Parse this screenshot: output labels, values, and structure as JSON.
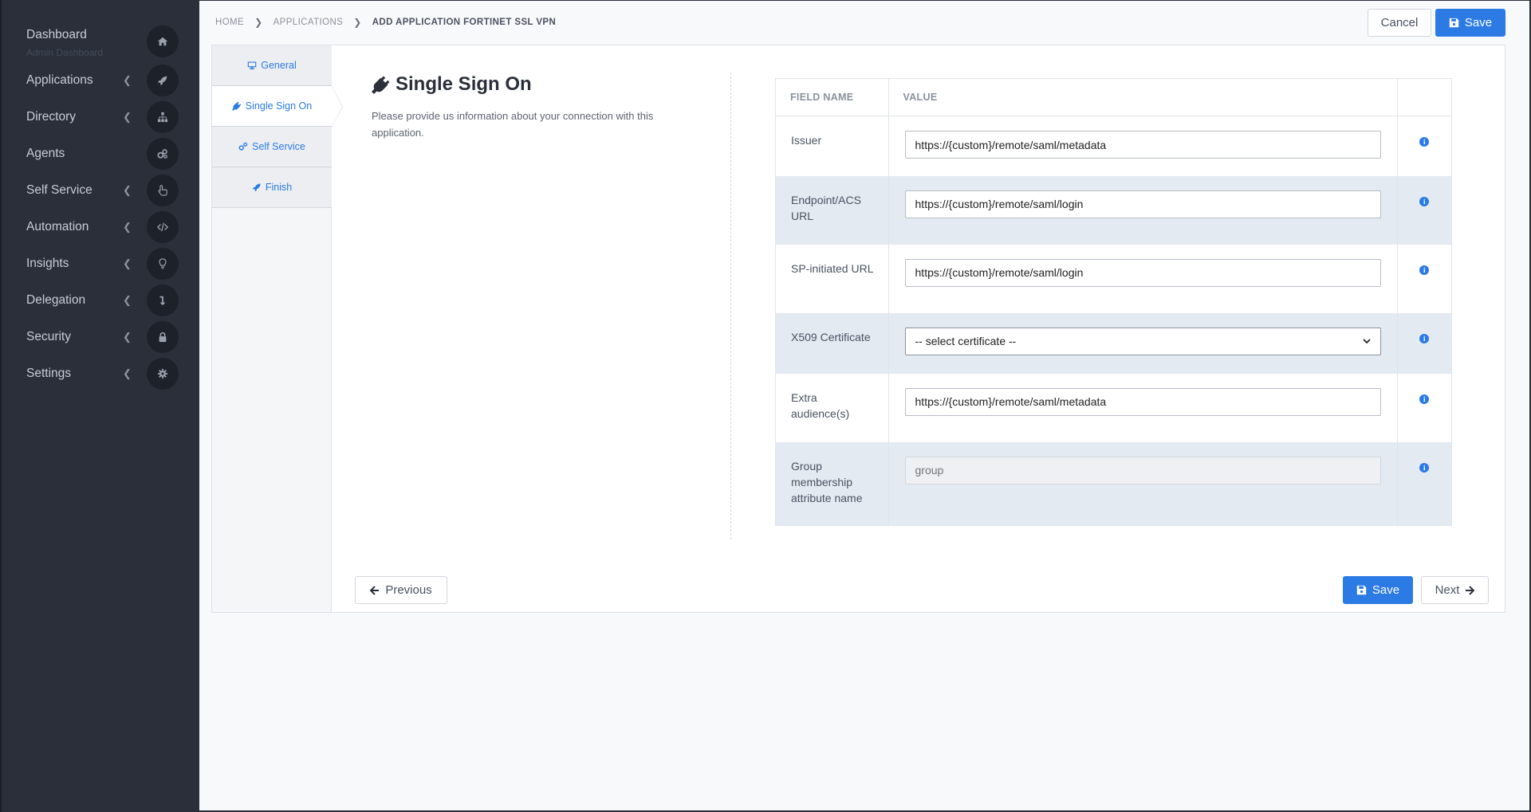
{
  "sidebar": {
    "dashboard": {
      "label": "Dashboard",
      "sub": "Admin Dashboard",
      "icon": "home-icon"
    },
    "items": [
      {
        "label": "Applications",
        "icon": "rocket-icon",
        "chevron": true
      },
      {
        "label": "Directory",
        "icon": "sitemap-icon",
        "chevron": true
      },
      {
        "label": "Agents",
        "icon": "cogs-icon",
        "chevron": false
      },
      {
        "label": "Self Service",
        "icon": "hand-pointer-icon",
        "chevron": true
      },
      {
        "label": "Automation",
        "icon": "code-icon",
        "chevron": true
      },
      {
        "label": "Insights",
        "icon": "lightbulb-icon",
        "chevron": true
      },
      {
        "label": "Delegation",
        "icon": "level-down-icon",
        "chevron": true
      },
      {
        "label": "Security",
        "icon": "lock-icon",
        "chevron": true
      },
      {
        "label": "Settings",
        "icon": "cog-icon",
        "chevron": true
      }
    ]
  },
  "breadcrumb": {
    "home": "HOME",
    "applications": "APPLICATIONS",
    "current": "ADD APPLICATION FORTINET SSL VPN"
  },
  "header": {
    "cancel_label": "Cancel",
    "save_label": "Save"
  },
  "tabs": [
    {
      "label": "General",
      "icon": "desktop-icon"
    },
    {
      "label": "Single Sign On",
      "icon": "plug-icon"
    },
    {
      "label": "Self Service",
      "icon": "cogs-icon"
    },
    {
      "label": "Finish",
      "icon": "rocket-icon"
    }
  ],
  "active_tab": "Single Sign On",
  "section": {
    "title": "Single Sign On",
    "description": "Please provide us information about your connection with this application."
  },
  "table": {
    "headers": {
      "name": "FIELD NAME",
      "value": "VALUE"
    },
    "rows": [
      {
        "name": "Issuer",
        "value": "https://{custom}/remote/saml/metadata",
        "placeholder": ""
      },
      {
        "name": "Endpoint/ACS URL",
        "value": "https://{custom}/remote/saml/login",
        "placeholder": ""
      },
      {
        "name": "SP-initiated URL",
        "value": "https://{custom}/remote/saml/login",
        "placeholder": ""
      },
      {
        "name": "X509 Certificate",
        "value": "-- select certificate --",
        "placeholder": ""
      },
      {
        "name": "Extra audience(s)",
        "value": "https://{custom}/remote/saml/metadata",
        "placeholder": ""
      },
      {
        "name": "Group membership attribute name",
        "value": "",
        "placeholder": "group"
      }
    ]
  },
  "footer": {
    "previous_label": "Previous",
    "save_label": "Save",
    "next_label": "Next"
  },
  "colors": {
    "accent": "#2c7be5",
    "sidebar_bg": "#2a2f3a",
    "row_alt": "#e4eaf2"
  }
}
